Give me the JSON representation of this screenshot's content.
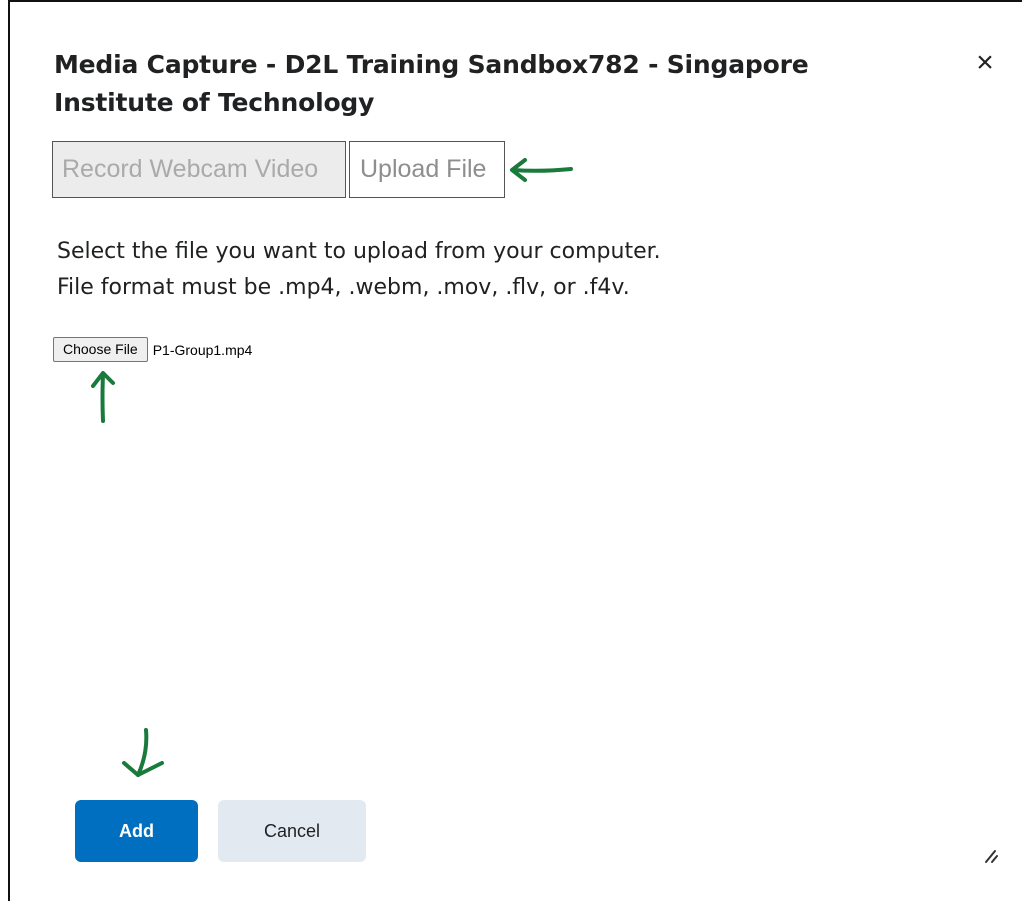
{
  "dialog": {
    "title": "Media Capture - D2L Training Sandbox782 - Singapore Institute of Technology",
    "close_label": "×"
  },
  "tabs": [
    {
      "label": "Record Webcam Video",
      "state": "disabled"
    },
    {
      "label": "Upload File",
      "state": "selected"
    }
  ],
  "instructions": {
    "line1": "Select the file you want to upload from your computer.",
    "line2": "File format must be .mp4, .webm, .mov, .flv, or .f4v."
  },
  "file_input": {
    "button_label": "Choose File",
    "file_name": "P1-Group1.mp4"
  },
  "actions": {
    "add_label": "Add",
    "cancel_label": "Cancel"
  },
  "colors": {
    "primary": "#006fbf",
    "secondary": "#e3e9f1",
    "annotation_arrow": "#1a7a3c"
  },
  "icons": {
    "close": "close-icon",
    "resize": "resize-grip-icon"
  }
}
